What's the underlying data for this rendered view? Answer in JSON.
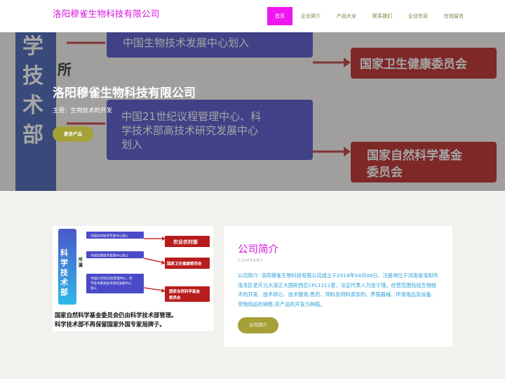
{
  "header": {
    "brand": "洛阳穆雀生物科技有限公司",
    "nav": [
      {
        "label": "首页",
        "active": true
      },
      {
        "label": "企业简介",
        "active": false
      },
      {
        "label": "产品大全",
        "active": false
      },
      {
        "label": "联系我们",
        "active": false
      },
      {
        "label": "企业信息",
        "active": false
      },
      {
        "label": "在线留言",
        "active": false
      }
    ]
  },
  "hero": {
    "title": "洛阳穆雀生物科技有限公司",
    "subtitle": "主营：生物技术的开发",
    "button": "更多产品",
    "background_text": {
      "left_col": "学技术部",
      "sub": "所",
      "box1": "中国生物技术发展中心划入",
      "box2_line1": "中国21世纪议程管理中心、科",
      "box2_line2": "学技术部高技术研究发展中心",
      "box2_line3": "划入",
      "red1": "国家卫生健康委员会",
      "red2_line1": "国家自然科学基金",
      "red2_line2": "委员会"
    }
  },
  "about": {
    "title": "公司简介",
    "subtitle_en": "COMPANY",
    "text": "公司简介: 洛阳穆雀生物科技有限公司成立于2018年04月08日，注册地位于河南省洛阳市洛龙区老开元大道正大国际西区CPL1211室，法定代表人为张宁瑾。经营范围包括生物技术的开发、技术转让、技术服务;兽药、饲料及饲料添加剂、养殖器械、环保用品及设备、宠物用品的销售;农产品的开发与种植。",
    "button": "公司简介",
    "diagram": {
      "left_col": "科学技术部",
      "sub": "所属",
      "blue1": "中国农村技术开发中心划入",
      "blue2": "中国生物技术发展中心划入",
      "blue3_line1": "中国21世纪议程管理中心、科",
      "blue3_line2": "学技术部高技术研究发展中心",
      "blue3_line3": "划入",
      "red1": "农业农村部",
      "red2": "国家卫生健康委员会",
      "red3_line1": "国家自然科学基金",
      "red3_line2": "委员会",
      "caption1": "国家自然科学基金委员会仍由科学技术部管理。",
      "caption2": "科学技术部不再保留国家外国专家局牌子。"
    }
  },
  "colors": {
    "brand": "#d816e0",
    "nav_active": "#ee18ee",
    "button": "#a5a038",
    "text_blue": "#2aa0d8"
  }
}
